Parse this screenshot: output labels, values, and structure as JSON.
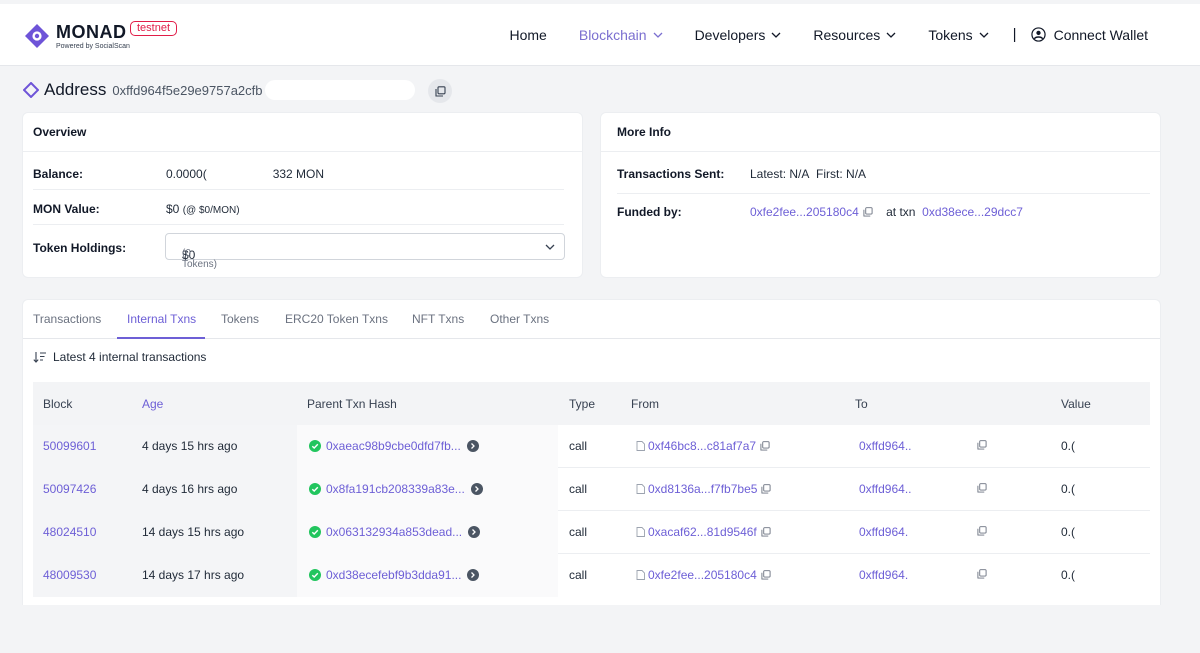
{
  "app": {
    "brand": "MONAD",
    "powered_by": "Powered by SocialScan",
    "network_badge": "testnet"
  },
  "nav": {
    "items": [
      {
        "label": "Home",
        "dropdown": false,
        "active": false
      },
      {
        "label": "Blockchain",
        "dropdown": true,
        "active": true
      },
      {
        "label": "Developers",
        "dropdown": true,
        "active": false
      },
      {
        "label": "Resources",
        "dropdown": true,
        "active": false
      },
      {
        "label": "Tokens",
        "dropdown": true,
        "active": false
      }
    ],
    "separator": "|",
    "connect_wallet": "Connect Wallet"
  },
  "address": {
    "label": "Address",
    "hash": "0xffd964f5e29e9757a2cfb"
  },
  "overview": {
    "title": "Overview",
    "balance_label": "Balance:",
    "balance_prefix": "0.0000(",
    "balance_suffix": "332 MON",
    "value_label": "MON Value:",
    "value_amount": "$0",
    "value_rate": "(@ $0/MON)",
    "holdings_label": "Token Holdings:",
    "holdings_amount": "$0",
    "holdings_count": "(0 Tokens)"
  },
  "more_info": {
    "title": "More Info",
    "sent_label": "Transactions Sent:",
    "sent_latest": "Latest: N/A",
    "sent_first": "First: N/A",
    "funded_label": "Funded by:",
    "funded_address": "0xfe2fee...205180c4",
    "at_txn_label": "at txn",
    "at_txn_hash": "0xd38ece...29dcc7"
  },
  "tabs": [
    {
      "label": "Transactions",
      "active": false
    },
    {
      "label": "Internal Txns",
      "active": true
    },
    {
      "label": "Tokens",
      "active": false
    },
    {
      "label": "ERC20 Token Txns",
      "active": false
    },
    {
      "label": "NFT Txns",
      "active": false
    },
    {
      "label": "Other Txns",
      "active": false
    }
  ],
  "table": {
    "summary": "Latest 4 internal transactions",
    "columns": {
      "block": "Block",
      "age": "Age",
      "parent": "Parent Txn Hash",
      "type": "Type",
      "from": "From",
      "to": "To",
      "value": "Value"
    },
    "rows": [
      {
        "block": "50099601",
        "age": "4 days 15 hrs ago",
        "parent": "0xaeac98b9cbe0dfd7fb...",
        "type": "call",
        "from": "0xf46bc8...c81af7a7",
        "to": "0xffd964..",
        "value": "0.("
      },
      {
        "block": "50097426",
        "age": "4 days 16 hrs ago",
        "parent": "0x8fa191cb208339a83e...",
        "type": "call",
        "from": "0xd8136a...f7fb7be5",
        "to": "0xffd964..",
        "value": "0.("
      },
      {
        "block": "48024510",
        "age": "14 days 15 hrs ago",
        "parent": "0x063132934a853dead...",
        "type": "call",
        "from": "0xacaf62...81d9546f",
        "to": "0xffd964.",
        "value": "0.("
      },
      {
        "block": "48009530",
        "age": "14 days 17 hrs ago",
        "parent": "0xd38ecefebf9b3dda91...",
        "type": "call",
        "from": "0xfe2fee...205180c4",
        "to": "0xffd964.",
        "value": "0.("
      }
    ]
  },
  "colors": {
    "accent": "#6d5fd6",
    "nav_active": "#7b6fd0",
    "brand": "#6e54d8",
    "success": "#22c55e",
    "badge": "#e11d48"
  },
  "icons": {
    "logo": "monad-logo-icon",
    "wallet": "user-circle-icon",
    "copy": "copy-icon",
    "chevron": "chevron-down-icon",
    "sort": "sort-icon",
    "success": "check-circle-icon",
    "arrow": "arrow-right-circle-icon",
    "document": "document-icon"
  }
}
